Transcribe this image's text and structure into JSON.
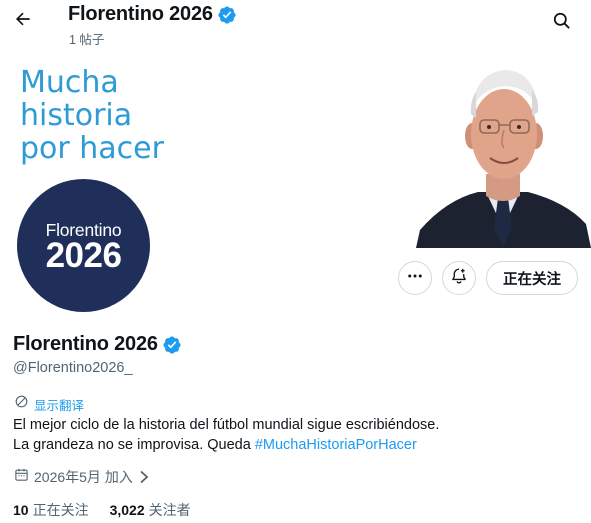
{
  "header": {
    "title": "Florentino 2026",
    "subtitle": "1 帖子",
    "back_icon": "arrow-left-icon",
    "search_icon": "search-icon"
  },
  "banner": {
    "slogan_line1": "Mucha",
    "slogan_line2": "historia",
    "slogan_line3": "por hacer"
  },
  "avatar": {
    "name": "Florentino",
    "year": "2026"
  },
  "actions": {
    "more_icon": "more-icon",
    "notify_icon": "bell-plus-icon",
    "follow_label": "正在关注"
  },
  "profile": {
    "name": "Florentino 2026",
    "handle": "@Florentino2026_",
    "translate_label": "显示翻译",
    "bio_line1": "El mejor ciclo de la historia del fútbol mundial sigue escribiéndose.",
    "bio_line2_prefix": "La grandeza no se improvisa. Queda ",
    "bio_hashtag": "#MuchaHistoriaPorHacer",
    "joined": "2026年5月 加入"
  },
  "stats": {
    "following_count": "10",
    "following_label": "正在关注",
    "followers_count": "3,022",
    "followers_label": "关注者"
  },
  "colors": {
    "accent": "#1d9bf0",
    "muted": "#536471",
    "avatar_bg": "#1f2f5a",
    "slogan": "#2e9bd6"
  }
}
